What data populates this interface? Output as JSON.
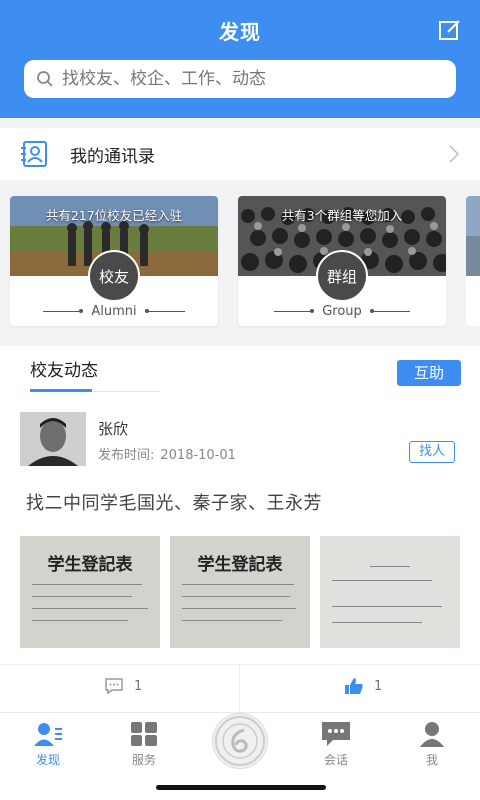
{
  "header": {
    "title": "发现",
    "edit_icon": "edit-icon"
  },
  "search": {
    "placeholder": "找校友、校企、工作、动态"
  },
  "contacts": {
    "label": "我的通讯录"
  },
  "cards": [
    {
      "caption": "共有217位校友已经入驻",
      "badge": "校友",
      "sub": "Alumni"
    },
    {
      "caption": "共有3个群组等您加入",
      "badge": "群组",
      "sub": "Group"
    }
  ],
  "feed": {
    "tab": "校友动态",
    "help_button": "互助",
    "post": {
      "author": "张欣",
      "time_label": "发布时间:",
      "time": "2018-10-01",
      "tag": "找人",
      "text": "找二中同学毛国光、秦子家、王永芳",
      "images": [
        {
          "title": "学生登記表"
        },
        {
          "title": "学生登記表"
        },
        {
          "title": ""
        }
      ]
    },
    "comments": "1",
    "likes": "1"
  },
  "tabbar": {
    "items": [
      {
        "label": "发现",
        "icon": "discover-icon"
      },
      {
        "label": "服务",
        "icon": "service-icon"
      },
      {
        "label": "会话",
        "icon": "chat-icon"
      },
      {
        "label": "我",
        "icon": "profile-icon"
      }
    ]
  },
  "colors": {
    "accent": "#3d8ef0",
    "background": "#f2f3f5"
  }
}
